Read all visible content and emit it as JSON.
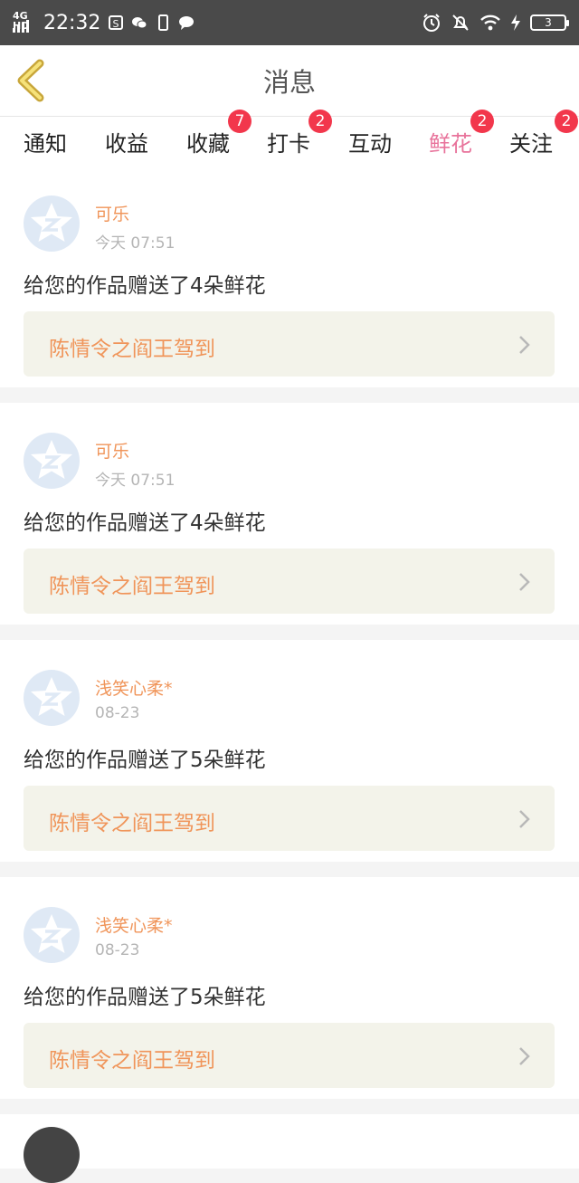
{
  "status_bar": {
    "network": "4G HD",
    "time": "22:32",
    "battery": "3"
  },
  "header": {
    "title": "消息"
  },
  "tabs": [
    {
      "label": "通知",
      "badge": ""
    },
    {
      "label": "收益",
      "badge": ""
    },
    {
      "label": "收藏",
      "badge": "7"
    },
    {
      "label": "打卡",
      "badge": "2"
    },
    {
      "label": "互动",
      "badge": ""
    },
    {
      "label": "鲜花",
      "badge": "2",
      "active": true
    },
    {
      "label": "关注",
      "badge": "2"
    }
  ],
  "messages": [
    {
      "user": "可乐",
      "time": "今天 07:51",
      "text": "给您的作品赠送了4朵鲜花",
      "work": "陈情令之阎王驾到"
    },
    {
      "user": "可乐",
      "time": "今天 07:51",
      "text": "给您的作品赠送了4朵鲜花",
      "work": "陈情令之阎王驾到"
    },
    {
      "user": "浅笑心柔*",
      "time": "08-23",
      "text": "给您的作品赠送了5朵鲜花",
      "work": "陈情令之阎王驾到"
    },
    {
      "user": "浅笑心柔*",
      "time": "08-23",
      "text": "给您的作品赠送了5朵鲜花",
      "work": "陈情令之阎王驾到"
    }
  ],
  "colors": {
    "accent": "#e8739b",
    "username": "#f0955a",
    "badge": "#f2374c",
    "status_bar": "#4a4a4a"
  }
}
